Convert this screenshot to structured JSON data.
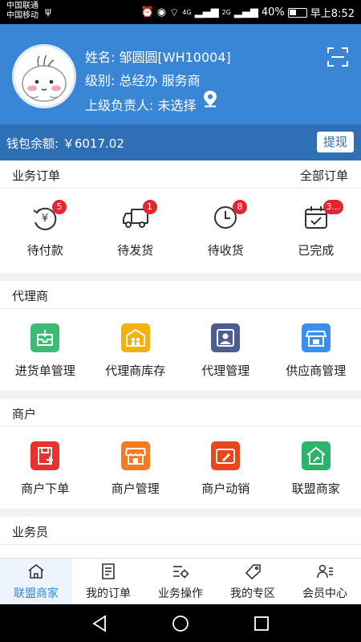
{
  "status_bar": {
    "carrier1": "中国联通",
    "carrier2": "中国移动",
    "battery": "40%",
    "time": "早上8:52",
    "net1": "4G",
    "net2": "2G"
  },
  "profile": {
    "name_label": "姓名:",
    "name_value": "邹圆圆[WH10004]",
    "level_label": "级别:",
    "level_value": "总经办 服务商",
    "superior_label": "上级负责人:",
    "superior_value": "未选择"
  },
  "wallet": {
    "label": "钱包余额:",
    "amount": "￥6017.02",
    "withdraw_label": "提现"
  },
  "orders": {
    "title": "业务订单",
    "more": "全部订单",
    "items": [
      {
        "label": "待付款",
        "badge": "5",
        "icon": "payment-icon"
      },
      {
        "label": "待发货",
        "badge": "1",
        "icon": "truck-icon"
      },
      {
        "label": "待收货",
        "badge": "8",
        "icon": "clock-icon"
      },
      {
        "label": "已完成",
        "badge": "3...",
        "icon": "calendar-check-icon"
      }
    ]
  },
  "agent": {
    "title": "代理商",
    "items": [
      {
        "label": "进货单管理",
        "icon": "inbox-icon",
        "color": "#3dbb74"
      },
      {
        "label": "代理商库存",
        "icon": "warehouse-icon",
        "color": "#f2b10d"
      },
      {
        "label": "代理管理",
        "icon": "agent-icon",
        "color": "#4c5d8f"
      },
      {
        "label": "供应商管理",
        "icon": "supplier-store-icon",
        "color": "#3b8ff0"
      }
    ]
  },
  "merchant": {
    "title": "商户",
    "items": [
      {
        "label": "商户下单",
        "icon": "order-icon",
        "color": "#e8322f"
      },
      {
        "label": "商户管理",
        "icon": "store-icon",
        "color": "#f57b22"
      },
      {
        "label": "商户动销",
        "icon": "card-edit-icon",
        "color": "#e8461b"
      },
      {
        "label": "联盟商家",
        "icon": "house-icon",
        "color": "#2cb36c"
      }
    ]
  },
  "salesman": {
    "title": "业务员"
  },
  "bottom_nav": {
    "items": [
      {
        "label": "联盟商家",
        "icon": "home-icon",
        "active": true
      },
      {
        "label": "我的订单",
        "icon": "order-list-icon",
        "active": false
      },
      {
        "label": "业务操作",
        "icon": "settings-list-icon",
        "active": false
      },
      {
        "label": "我的专区",
        "icon": "tag-icon",
        "active": false
      },
      {
        "label": "会员中心",
        "icon": "member-icon",
        "active": false
      }
    ]
  },
  "colors": {
    "header_blue": "#3a86d6",
    "wallet_blue": "#2f6fb6",
    "badge_red": "#e6242d"
  }
}
